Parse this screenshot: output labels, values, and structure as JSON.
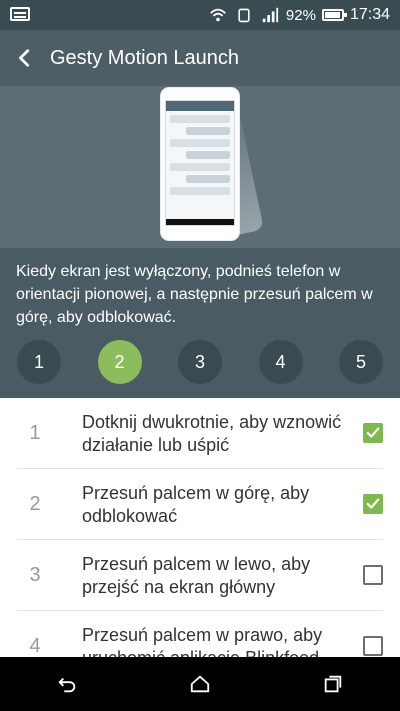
{
  "status_bar": {
    "battery_percent": "92%",
    "battery_level": 0.92,
    "time": "17:34",
    "icons": [
      "notification-icon",
      "wifi-icon",
      "sim-icon",
      "signal-icon",
      "battery-icon"
    ]
  },
  "header": {
    "back_icon": "chevron-left-icon",
    "title": "Gesty Motion Launch"
  },
  "hero": {
    "illustration": "phone-swipe-up-illustration"
  },
  "instruction": {
    "text": "Kiedy ekran jest wyłączony, podnieś telefon w orientacji pionowej, a następnie przesuń palcem w górę, aby odblokować."
  },
  "steps": [
    {
      "label": "1",
      "active": false
    },
    {
      "label": "2",
      "active": true
    },
    {
      "label": "3",
      "active": false
    },
    {
      "label": "4",
      "active": false
    },
    {
      "label": "5",
      "active": false
    }
  ],
  "gestures": [
    {
      "number": "1",
      "text": "Dotknij dwukrotnie, aby wznowić działanie lub uśpić",
      "checked": true
    },
    {
      "number": "2",
      "text": "Przesuń palcem w górę, aby odblokować",
      "checked": true
    },
    {
      "number": "3",
      "text": "Przesuń palcem w lewo, aby przejść na ekran główny",
      "checked": false
    },
    {
      "number": "4",
      "text": "Przesuń palcem w prawo, aby uruchomić aplikację Blinkfeed",
      "checked": false
    }
  ],
  "nav": [
    "back-icon",
    "home-icon",
    "recents-icon"
  ],
  "colors": {
    "status_bar": "#3a4b52",
    "header": "#4d5e66",
    "hero": "#5c6d75",
    "info": "#4a5b63",
    "accent_green": "#8cbc5c",
    "checkbox_green": "#7fb84f"
  }
}
